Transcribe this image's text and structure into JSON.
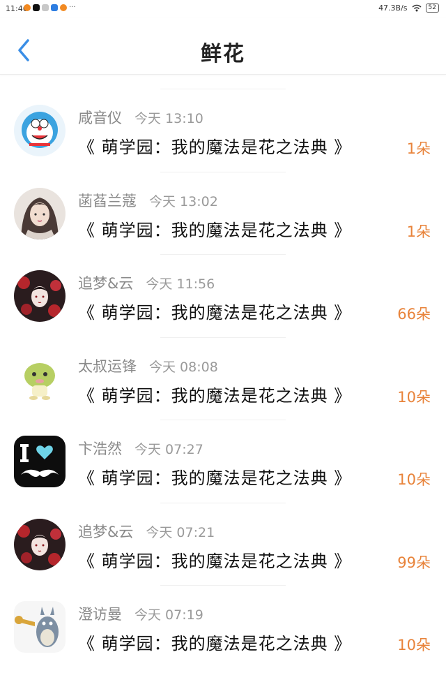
{
  "status_bar": {
    "time": "11:46",
    "net_speed": "47.3B/s",
    "battery": "52",
    "notif_more": "···"
  },
  "header": {
    "title": "鲜花"
  },
  "items": [
    {
      "user": "咸音仪",
      "time": "今天 13:10",
      "book": "《 萌学园：我的魔法是花之法典 》",
      "count": "1朵"
    },
    {
      "user": "菡萏兰蔻",
      "time": "今天 13:02",
      "book": "《 萌学园：我的魔法是花之法典 》",
      "count": "1朵"
    },
    {
      "user": "追梦&云",
      "time": "今天 11:56",
      "book": "《 萌学园：我的魔法是花之法典 》",
      "count": "66朵"
    },
    {
      "user": "太叔运锋",
      "time": "今天 08:08",
      "book": "《 萌学园：我的魔法是花之法典 》",
      "count": "10朵"
    },
    {
      "user": "卞浩然",
      "time": "今天 07:27",
      "book": "《 萌学园：我的魔法是花之法典 》",
      "count": "10朵"
    },
    {
      "user": "追梦&云",
      "time": "今天 07:21",
      "book": "《 萌学园：我的魔法是花之法典 》",
      "count": "99朵"
    },
    {
      "user": "澄访曼",
      "time": "今天 07:19",
      "book": "《 萌学园：我的魔法是花之法典 》",
      "count": "10朵"
    }
  ],
  "colors": {
    "accent": "#3a8ee6",
    "count": "#e8833a"
  }
}
